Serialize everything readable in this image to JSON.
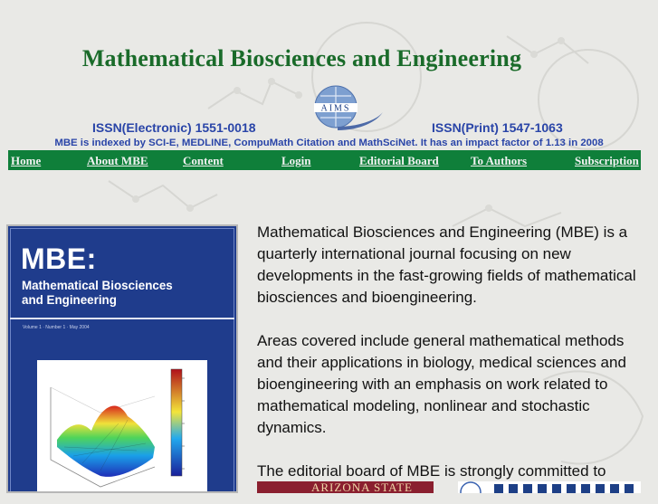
{
  "header": {
    "title": "Mathematical Biosciences and Engineering",
    "logo_text": "AIMS",
    "issn_electronic": "ISSN(Electronic) 1551-0018",
    "issn_print": "ISSN(Print) 1547-1063",
    "index_line": "MBE is indexed by SCI-E, MEDLINE, CompuMath Citation and MathSciNet. It has an impact factor of 1.13 in 2008"
  },
  "nav": {
    "items": [
      {
        "label": "Home"
      },
      {
        "label": "About MBE"
      },
      {
        "label": "Content"
      },
      {
        "label": "Login"
      },
      {
        "label": "Editorial Board"
      },
      {
        "label": "To Authors"
      },
      {
        "label": "Subscription"
      }
    ]
  },
  "cover": {
    "abbr": "MBE:",
    "line1": "Mathematical Biosciences",
    "line2": "and Engineering",
    "volume": "Volume 1 · Number 1 · May 2004"
  },
  "intro": {
    "p1": "Mathematical Biosciences and Engineering (MBE) is a quarterly international journal focusing on new developments in the fast-growing fields of mathematical biosciences and bioengineering.",
    "p2": "Areas covered include general mathematical methods and their applications in biology, medical sciences and bioengineering with an emphasis on work related to mathematical modeling, nonlinear and stochastic dynamics.",
    "p3": "The editorial board of MBE is strongly committed to"
  },
  "partners": {
    "asu": "ARIZONA STATE"
  },
  "colors": {
    "title_green": "#1a6b2a",
    "issn_blue": "#2a45a8",
    "nav_green": "#0f7f3a",
    "cover_blue": "#1f3c8c"
  }
}
